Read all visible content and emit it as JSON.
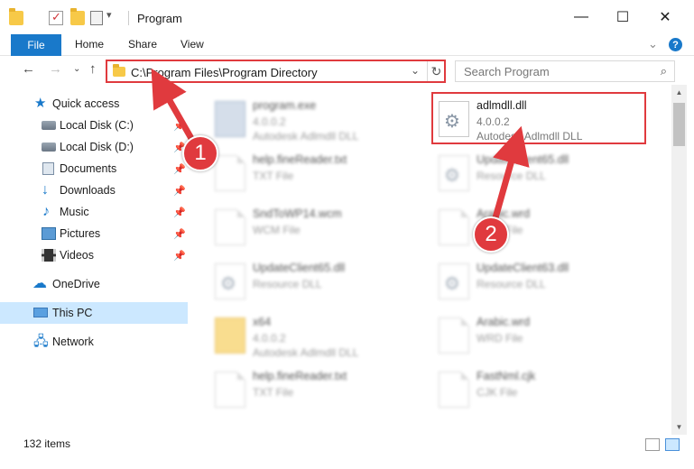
{
  "window": {
    "title": "Program",
    "minimize": "—",
    "maximize": "☐",
    "close": "✕"
  },
  "ribbon": {
    "tabs": [
      "File",
      "Home",
      "Share",
      "View"
    ],
    "help": "?"
  },
  "nav": {
    "address": "C:\\Program Files\\Program Directory",
    "search_placeholder": "Search Program"
  },
  "sidebar": {
    "items": [
      {
        "label": "Quick access",
        "icon": "star-icon"
      },
      {
        "label": "Local Disk (C:)",
        "icon": "disk-icon"
      },
      {
        "label": "Local Disk (D:)",
        "icon": "disk-icon"
      },
      {
        "label": "Documents",
        "icon": "documents-icon"
      },
      {
        "label": "Downloads",
        "icon": "download-icon"
      },
      {
        "label": "Music",
        "icon": "music-icon"
      },
      {
        "label": "Pictures",
        "icon": "pictures-icon"
      },
      {
        "label": "Videos",
        "icon": "videos-icon"
      },
      {
        "label": "OneDrive",
        "icon": "cloud-icon"
      },
      {
        "label": "This PC",
        "icon": "computer-icon"
      },
      {
        "label": "Network",
        "icon": "network-icon"
      }
    ]
  },
  "files": [
    {
      "name": "program.exe",
      "line2": "4.0.0.2",
      "line3": "Autodesk Adlmdll DLL",
      "icon": "exe-icon"
    },
    {
      "name": "adlmdll.dll",
      "line2": "4.0.0.2",
      "line3": "Autodesk Adlmdll DLL",
      "icon": "dll-icon"
    },
    {
      "name": "help.fineReader.txt",
      "line2": "TXT File",
      "icon": "document-icon"
    },
    {
      "name": "UpdateClient65.dll",
      "line2": "Resource DLL",
      "icon": "dll-icon"
    },
    {
      "name": "SndToWP14.wcm",
      "line2": "WCM File",
      "icon": "document-icon"
    },
    {
      "name": "Arabic.wrd",
      "line2": "WRD File",
      "icon": "document-icon"
    },
    {
      "name": "UpdateClient65.dll",
      "line2": "Resource DLL",
      "icon": "dll-icon"
    },
    {
      "name": "UpdateClient63.dll",
      "line2": "Resource DLL",
      "icon": "dll-icon"
    },
    {
      "name": "x64",
      "line2": "4.0.0.2",
      "line3": "Autodesk Adlmdll DLL",
      "icon": "folder-icon"
    },
    {
      "name": "Arabic.wrd",
      "line2": "WRD File",
      "icon": "document-icon"
    },
    {
      "name": "help.fineReader.txt",
      "line2": "TXT File",
      "icon": "document-icon"
    },
    {
      "name": "FastNml.cjk",
      "line2": "CJK File",
      "icon": "document-icon"
    }
  ],
  "status": {
    "count": "132 items"
  },
  "annotations": {
    "step1": "1",
    "step2": "2",
    "color": "#e03a3e"
  }
}
